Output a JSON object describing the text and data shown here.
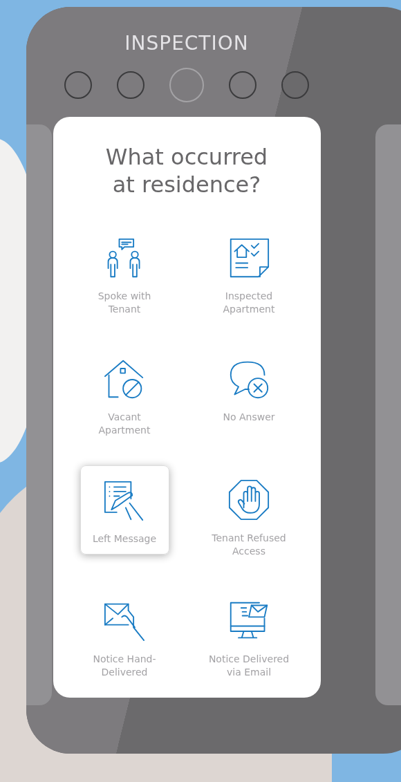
{
  "header": {
    "title": "INSPECTION"
  },
  "steps": [
    {
      "selected": false
    },
    {
      "selected": false
    },
    {
      "selected": true
    },
    {
      "selected": false
    },
    {
      "selected": false
    }
  ],
  "question": "What occurred\nat residence?",
  "options": [
    {
      "label": "Spoke with\nTenant",
      "selected": false
    },
    {
      "label": "Inspected\nApartment",
      "selected": false
    },
    {
      "label": "Vacant\nApartment",
      "selected": false
    },
    {
      "label": "No Answer",
      "selected": false
    },
    {
      "label": "Left Message",
      "selected": true
    },
    {
      "label": "Tenant Refused\nAccess",
      "selected": false
    },
    {
      "label": "Notice Hand-\nDelivered",
      "selected": false
    },
    {
      "label": "Notice Delivered\nvia Email",
      "selected": false
    }
  ]
}
